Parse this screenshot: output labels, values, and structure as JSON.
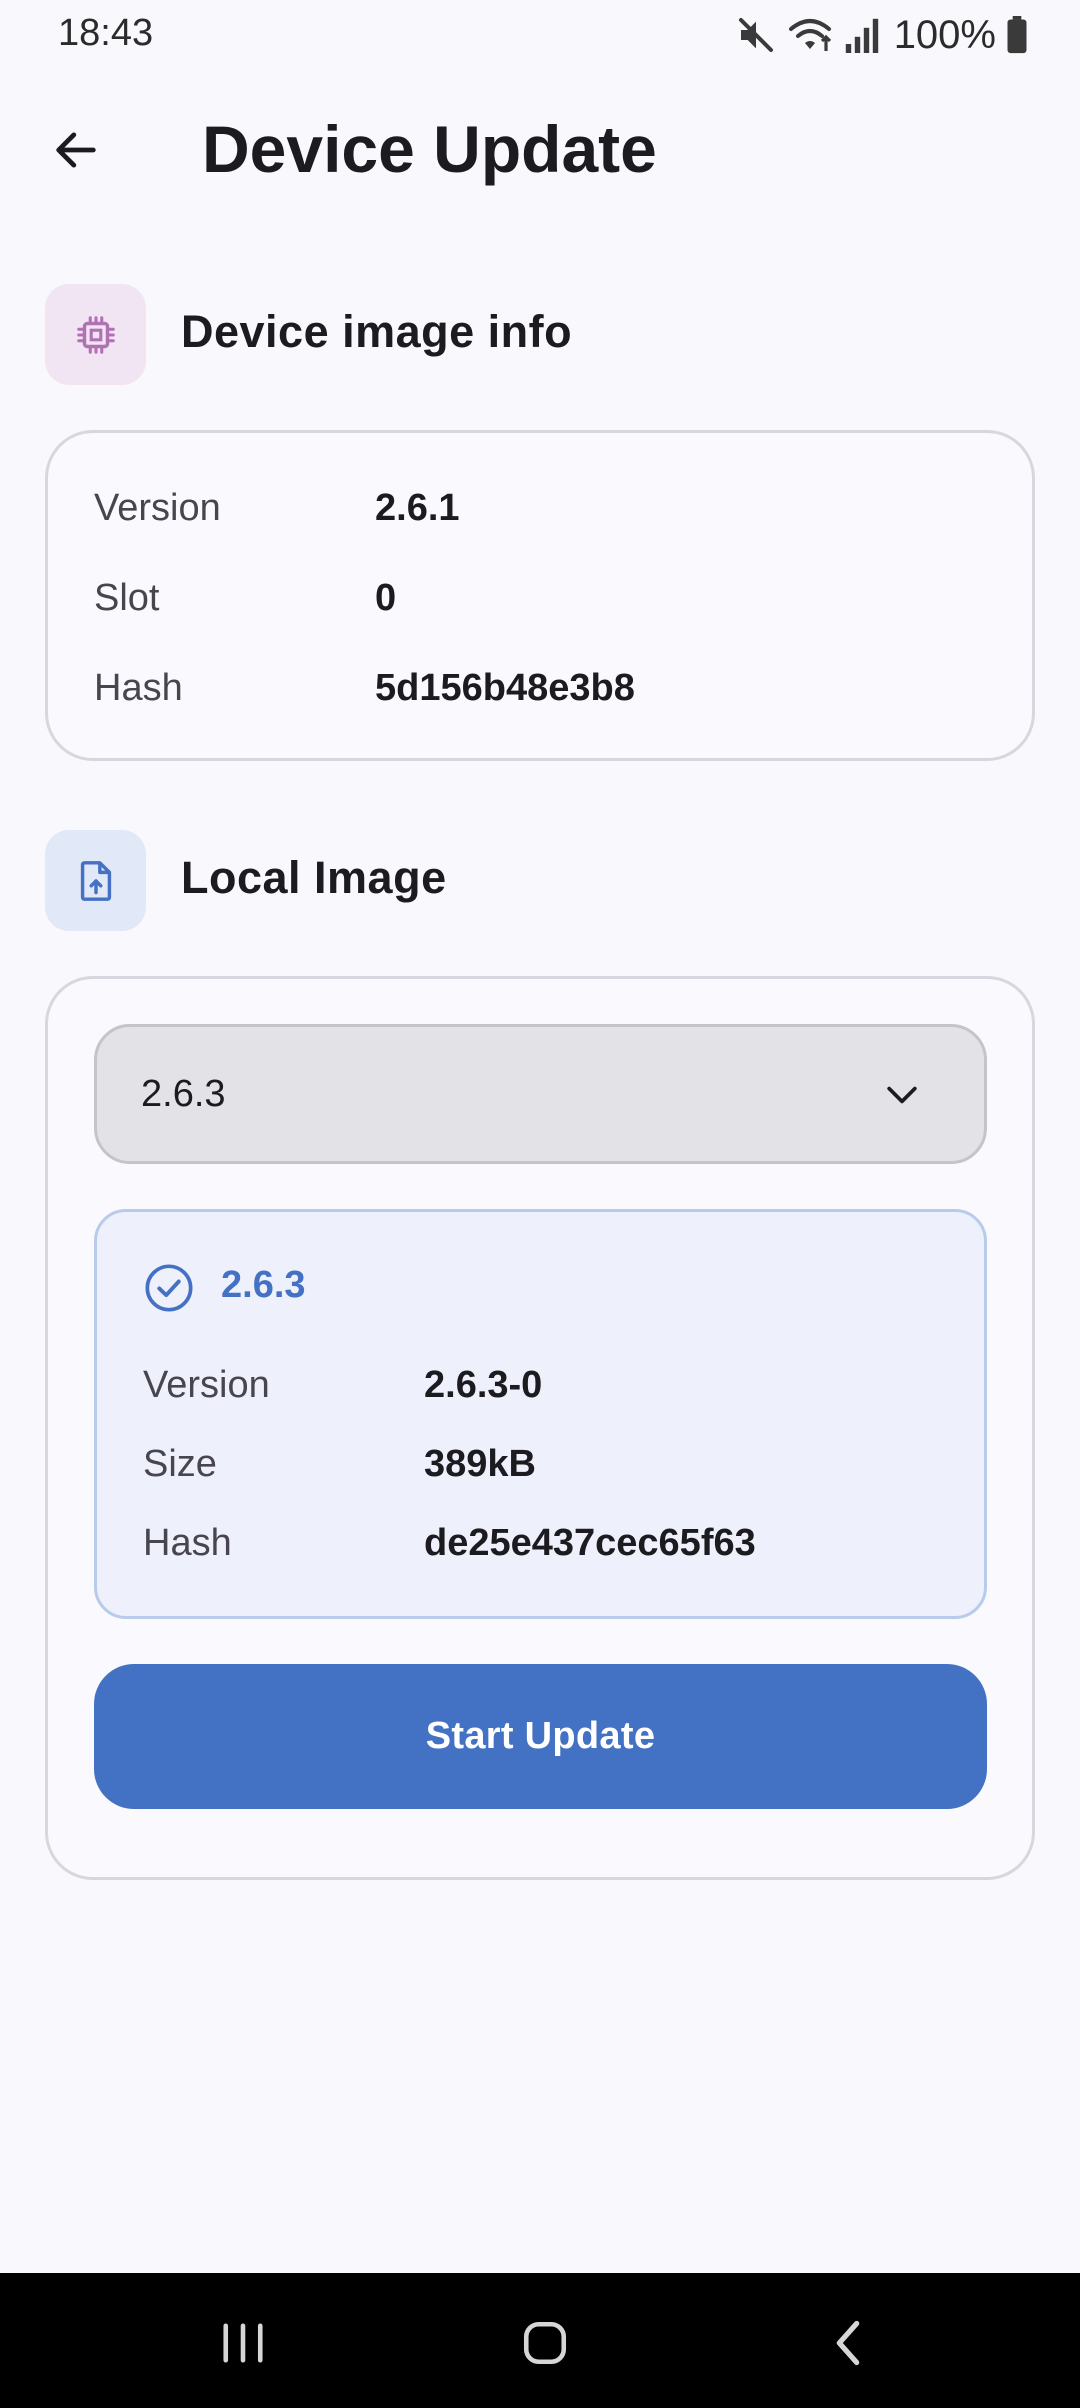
{
  "status_bar": {
    "time": "18:43",
    "battery_percent": "100%",
    "icons": [
      "mute-icon",
      "wifi-icon",
      "signal-icon",
      "battery-icon"
    ]
  },
  "app_bar": {
    "title": "Device Update",
    "back_icon": "arrow-back-icon"
  },
  "device_section": {
    "title": "Device image info",
    "icon": "chip-icon",
    "icon_color": "#b071b5",
    "icon_bg": "#f1e5f3",
    "rows": [
      {
        "label": "Version",
        "value": "2.6.1"
      },
      {
        "label": "Slot",
        "value": "0"
      },
      {
        "label": "Hash",
        "value": "5d156b48e3b8"
      }
    ]
  },
  "local_section": {
    "title": "Local Image",
    "icon": "file-upload-icon",
    "icon_color": "#4571c4",
    "icon_bg": "#e1e8f7",
    "dropdown": {
      "selected": "2.6.3",
      "icon": "chevron-down-icon"
    },
    "selected_image": {
      "title": "2.6.3",
      "icon": "check-circle-icon",
      "rows": [
        {
          "label": "Version",
          "value": "2.6.3-0"
        },
        {
          "label": "Size",
          "value": "389kB"
        },
        {
          "label": "Hash",
          "value": "de25e437cec65f63"
        }
      ]
    },
    "start_button": "Start Update"
  },
  "nav_bar": {
    "buttons": [
      "recents-icon",
      "home-icon",
      "back-icon"
    ]
  },
  "colors": {
    "background": "#f8f8fd",
    "accent": "#4372c4",
    "card_border": "#d8d6de",
    "panel_bg": "#eef1fb"
  }
}
